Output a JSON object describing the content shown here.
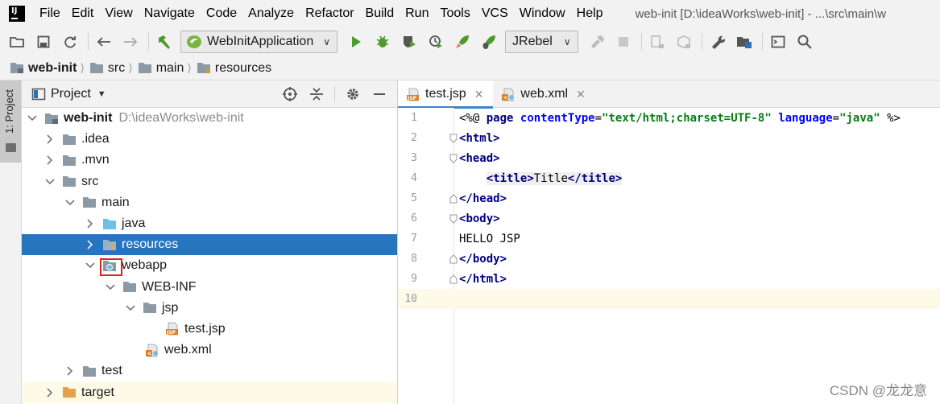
{
  "menubar": {
    "items": [
      {
        "label": "File"
      },
      {
        "label": "Edit"
      },
      {
        "label": "View"
      },
      {
        "label": "Navigate"
      },
      {
        "label": "Code"
      },
      {
        "label": "Analyze"
      },
      {
        "label": "Refactor"
      },
      {
        "label": "Build"
      },
      {
        "label": "Run"
      },
      {
        "label": "Tools"
      },
      {
        "label": "VCS"
      },
      {
        "label": "Window"
      },
      {
        "label": "Help"
      }
    ],
    "window_title": "web-init [D:\\ideaWorks\\web-init] - ...\\src\\main\\w"
  },
  "toolbar": {
    "run_config": "WebInitApplication",
    "jrebel": "JRebel"
  },
  "breadcrumb": {
    "items": [
      "web-init",
      "src",
      "main",
      "resources"
    ]
  },
  "left_strip": {
    "tab_label": "1: Project"
  },
  "project_panel": {
    "title": "Project",
    "tree": [
      {
        "label": "web-init",
        "path": "D:\\ideaWorks\\web-init"
      },
      {
        "label": ".idea"
      },
      {
        "label": ".mvn"
      },
      {
        "label": "src"
      },
      {
        "label": "main"
      },
      {
        "label": "java"
      },
      {
        "label": "resources"
      },
      {
        "label": "webapp"
      },
      {
        "label": "WEB-INF"
      },
      {
        "label": "jsp"
      },
      {
        "label": "test.jsp"
      },
      {
        "label": "web.xml"
      },
      {
        "label": "test"
      },
      {
        "label": "target"
      }
    ]
  },
  "editor": {
    "tabs": [
      {
        "label": "test.jsp"
      },
      {
        "label": "web.xml"
      }
    ],
    "line_numbers": [
      "1",
      "2",
      "3",
      "4",
      "5",
      "6",
      "7",
      "8",
      "9",
      "10"
    ],
    "code": {
      "l1_open": "<%@",
      "l1_page": "page",
      "l1_ct_attr": "contentType",
      "l1_eq1": "=",
      "l1_ct_val": "\"text/html;charset=UTF-8\"",
      "l1_lang_attr": "language",
      "l1_eq2": "=",
      "l1_lang_val": "\"java\"",
      "l1_close": "%>",
      "html_open": "html",
      "head_open": "head",
      "title_tag": "title",
      "title_text": "Title",
      "head_close": "head",
      "body_open": "body",
      "body_text": "HELLO JSP",
      "body_close": "body",
      "html_close": "html"
    }
  },
  "watermark": "CSDN @龙龙意"
}
